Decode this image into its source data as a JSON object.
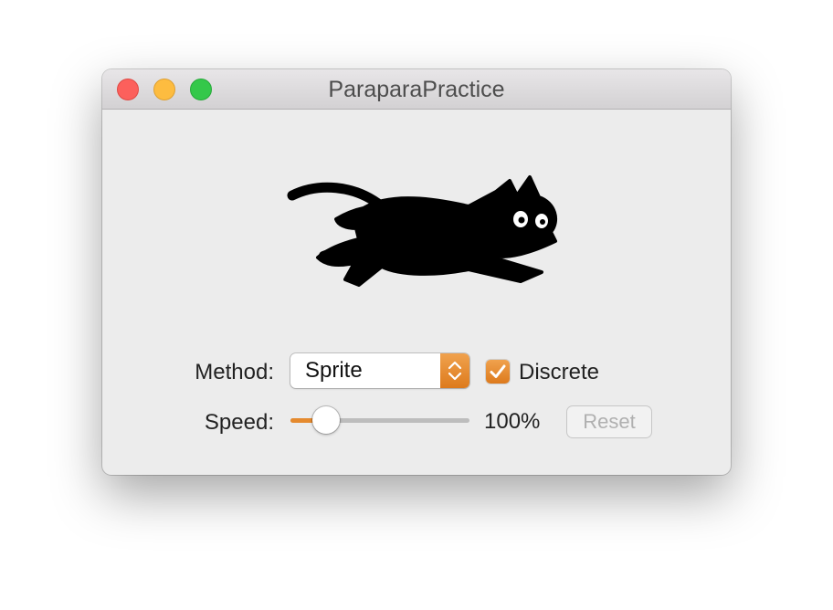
{
  "window": {
    "title": "ParaparaPractice"
  },
  "sprite": {
    "icon": "running-black-cat"
  },
  "method": {
    "label": "Method:",
    "selected": "Sprite"
  },
  "discrete": {
    "label": "Discrete",
    "checked": true
  },
  "speed": {
    "label": "Speed:",
    "value": 0.2,
    "value_text": "100%"
  },
  "reset": {
    "label": "Reset",
    "enabled": false
  },
  "colors": {
    "accent": "#e58a2e",
    "window_bg": "#ececec",
    "close": "#fc605c",
    "minimize": "#fdbc40",
    "zoom": "#34c84a"
  }
}
